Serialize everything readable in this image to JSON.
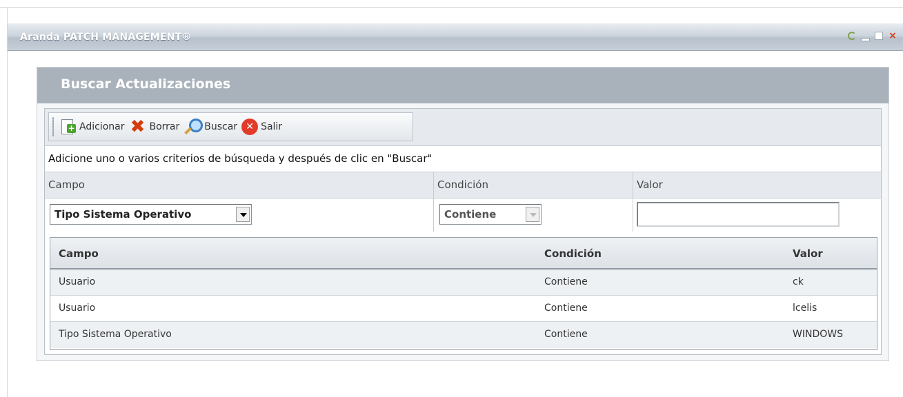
{
  "window": {
    "title": "Aranda PATCH MANAGEMENT®",
    "controls": [
      "refresh-icon",
      "minimize-icon",
      "maximize-icon",
      "close-icon"
    ],
    "close_glyph": "×"
  },
  "panel": {
    "title": "Buscar Actualizaciones"
  },
  "toolbar": {
    "add_label": "Adicionar",
    "delete_label": "Borrar",
    "search_label": "Buscar",
    "exit_label": "Salir"
  },
  "hint": "Adicione uno o varios criterios de búsqueda y después de clic en \"Buscar\"",
  "criteria": {
    "headers": {
      "field": "Campo",
      "condition": "Condición",
      "value": "Valor"
    },
    "field_selected": "Tipo Sistema Operativo",
    "condition_selected": "Contiene",
    "value_input": ""
  },
  "grid": {
    "headers": {
      "field": "Campo",
      "condition": "Condición",
      "value": "Valor"
    },
    "rows": [
      {
        "field": "Usuario",
        "condition": "Contiene",
        "value": "ck"
      },
      {
        "field": "Usuario",
        "condition": "Contiene",
        "value": "lcelis"
      },
      {
        "field": "Tipo Sistema Operativo",
        "condition": "Contiene",
        "value": "WINDOWS"
      }
    ]
  },
  "colors": {
    "titlebar_text": "#ffffff",
    "panel_header": "#a9b2bb",
    "close_accent": "#d23a12",
    "exit_icon": "#e23b2a"
  }
}
